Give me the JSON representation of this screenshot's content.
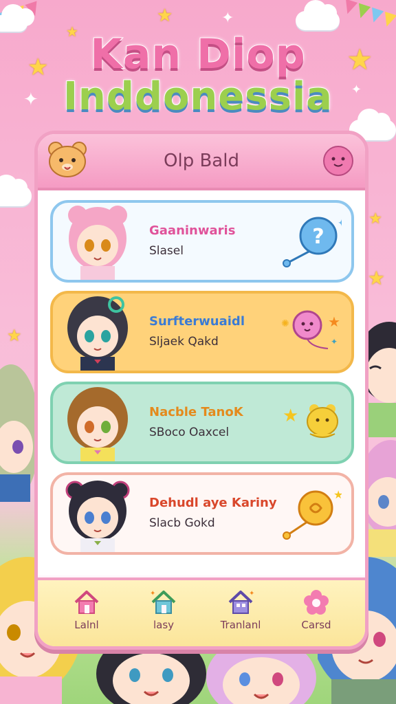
{
  "title": {
    "line1": "Kan Diop",
    "line2": "Inddonessia"
  },
  "panel": {
    "header_title": "Olp Bald"
  },
  "cards": [
    {
      "name": "Gaaninwaris",
      "subtitle": "Slasel",
      "badge": "question-balloon-icon",
      "accent": "#8ec7ee"
    },
    {
      "name": "Surfterwuaidl",
      "subtitle": "Sljaek Qakd",
      "badge": "pink-balloon-icon",
      "accent": "#f3b84a"
    },
    {
      "name": "Nacble TanoK",
      "subtitle": "SBoco Oaxcel",
      "badge": "yellow-bear-icon",
      "accent": "#7fd1b1"
    },
    {
      "name": "Dehudl aye Kariny",
      "subtitle": "Slacb Gokd",
      "badge": "orange-balloon-icon",
      "accent": "#f2b3a6"
    }
  ],
  "nav": [
    {
      "label": "Lalnl",
      "icon": "house-pink-icon"
    },
    {
      "label": "lasy",
      "icon": "house-green-icon"
    },
    {
      "label": "Tranlanl",
      "icon": "house-purple-icon"
    },
    {
      "label": "Carsd",
      "icon": "flower-icon"
    }
  ],
  "colors": {
    "background": "#f7a9cc",
    "panel_border": "#f1a1c4",
    "nav_bg": "#fbe59a"
  }
}
